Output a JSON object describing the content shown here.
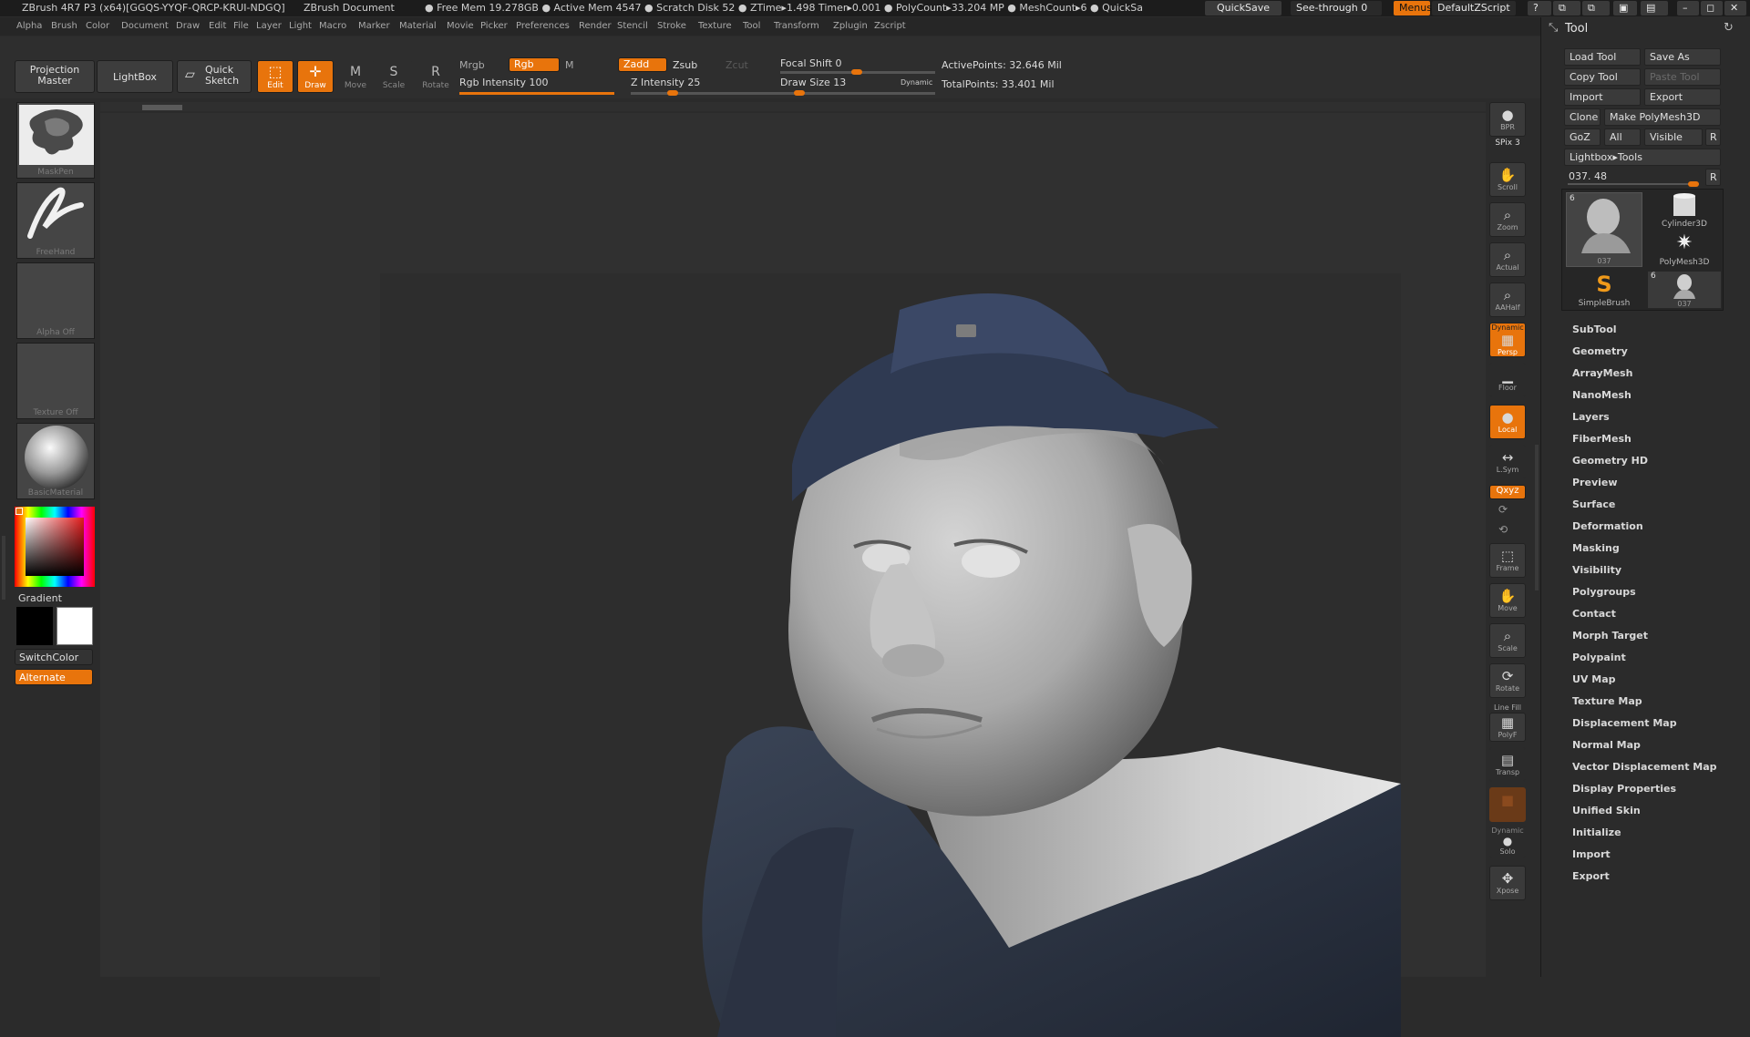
{
  "title_bar": {
    "app": "ZBrush 4R7 P3 (x64)[GGQS-YYQF-QRCP-KRUI-NDGQ]",
    "document": "ZBrush Document",
    "stats": "● Free Mem 19.278GB ● Active Mem 4547 ● Scratch Disk 52 ● ZTime▸1.498 Timer▸0.001 ● PolyCount▸33.204 MP ● MeshCount▸6 ● QuickSa",
    "quicksave": "QuickSave",
    "see_through": "See-through 0",
    "menus": "Menus",
    "script": "DefaultZScript"
  },
  "menubar": [
    "Alpha",
    "Brush",
    "Color",
    "Document",
    "Draw",
    "Edit",
    "File",
    "Layer",
    "Light",
    "Macro",
    "Marker",
    "Material",
    "Movie",
    "Picker",
    "Preferences",
    "Render",
    "Stencil",
    "Stroke",
    "Texture",
    "Tool",
    "Transform",
    "Zplugin",
    "Zscript"
  ],
  "toolbar": {
    "projection_master": "Projection Master",
    "lightbox": "LightBox",
    "quick_sketch": "Quick Sketch",
    "edit": "Edit",
    "draw": "Draw",
    "move": "Move",
    "scale": "Scale",
    "rotate": "Rotate",
    "mrgb": "Mrgb",
    "rgb": "Rgb",
    "m": "M",
    "zadd": "Zadd",
    "zsub": "Zsub",
    "zcut": "Zcut",
    "rgb_intensity": "Rgb Intensity 100",
    "z_intensity": "Z Intensity 25",
    "focal_shift": "Focal Shift 0",
    "draw_size": "Draw Size 13",
    "dynamic": "Dynamic",
    "active_points": "ActivePoints: 32.646 Mil",
    "total_points": "TotalPoints: 33.401 Mil"
  },
  "left_panel": {
    "brush": "MaskPen",
    "stroke": "FreeHand",
    "alpha": "Alpha Off",
    "texture": "Texture Off",
    "material": "BasicMaterial",
    "gradient": "Gradient",
    "switch_color": "SwitchColor",
    "alternate": "Alternate"
  },
  "right_shelf": [
    {
      "icon": "bpr-icon",
      "glyph": "●",
      "label": "BPR"
    },
    {
      "icon": "scroll-icon",
      "glyph": "✋",
      "label": "Scroll"
    },
    {
      "icon": "zoom-icon",
      "glyph": "⌕",
      "label": "Zoom"
    },
    {
      "icon": "actual-icon",
      "glyph": "⌕",
      "label": "Actual"
    },
    {
      "icon": "aahalf-icon",
      "glyph": "⌕",
      "label": "AAHalf"
    },
    {
      "icon": "persp-icon",
      "glyph": "▦",
      "label": "Persp"
    },
    {
      "icon": "floor-icon",
      "glyph": "▁",
      "label": "Floor"
    },
    {
      "icon": "local-icon",
      "glyph": "●",
      "label": "Local"
    },
    {
      "icon": "lsym-icon",
      "glyph": "↔",
      "label": "L.Sym"
    },
    {
      "icon": "frame-icon",
      "glyph": "⬚",
      "label": "Frame"
    },
    {
      "icon": "move-icon",
      "glyph": "✋",
      "label": "Move"
    },
    {
      "icon": "scale-icon",
      "glyph": "⌕",
      "label": "Scale"
    },
    {
      "icon": "rotate-icon",
      "glyph": "⟳",
      "label": "Rotate"
    },
    {
      "icon": "polyf-icon",
      "glyph": "▦",
      "label": "PolyF"
    },
    {
      "icon": "transp-icon",
      "glyph": "▤",
      "label": "Transp"
    },
    {
      "icon": "ghost-icon",
      "glyph": "■",
      "label": ""
    },
    {
      "icon": "solo-icon",
      "glyph": "●",
      "label": "Solo"
    },
    {
      "icon": "xpose-icon",
      "glyph": "✥",
      "label": "Xpose"
    }
  ],
  "shelf_misc": {
    "spix": "SPix 3",
    "dynamic": "Dynamic",
    "xyz": "Qxyz",
    "line_fill": "Line Fill"
  },
  "tool_panel": {
    "title": "Tool",
    "load_tool": "Load Tool",
    "save_as": "Save As",
    "copy_tool": "Copy Tool",
    "paste_tool": "Paste Tool",
    "import": "Import",
    "export": "Export",
    "clone": "Clone",
    "make_polymesh": "Make PolyMesh3D",
    "goz": "GoZ",
    "all": "All",
    "visible": "Visible",
    "r": "R",
    "lightbox_tools": "Lightbox▸Tools",
    "current_value": "037. 48",
    "tools": [
      {
        "name": "037",
        "count": "6"
      },
      {
        "name": "Cylinder3D",
        "count": ""
      },
      {
        "name": "PolyMesh3D",
        "count": ""
      },
      {
        "name": "SimpleBrush",
        "count": ""
      },
      {
        "name": "037",
        "count": "6"
      }
    ],
    "menu": [
      "SubTool",
      "Geometry",
      "ArrayMesh",
      "NanoMesh",
      "Layers",
      "FiberMesh",
      "Geometry HD",
      "Preview",
      "Surface",
      "Deformation",
      "Masking",
      "Visibility",
      "Polygroups",
      "Contact",
      "Morph Target",
      "Polypaint",
      "UV Map",
      "Texture Map",
      "Displacement Map",
      "Normal Map",
      "Vector Displacement Map",
      "Display Properties",
      "Unified Skin",
      "Initialize",
      "Import",
      "Export"
    ]
  }
}
